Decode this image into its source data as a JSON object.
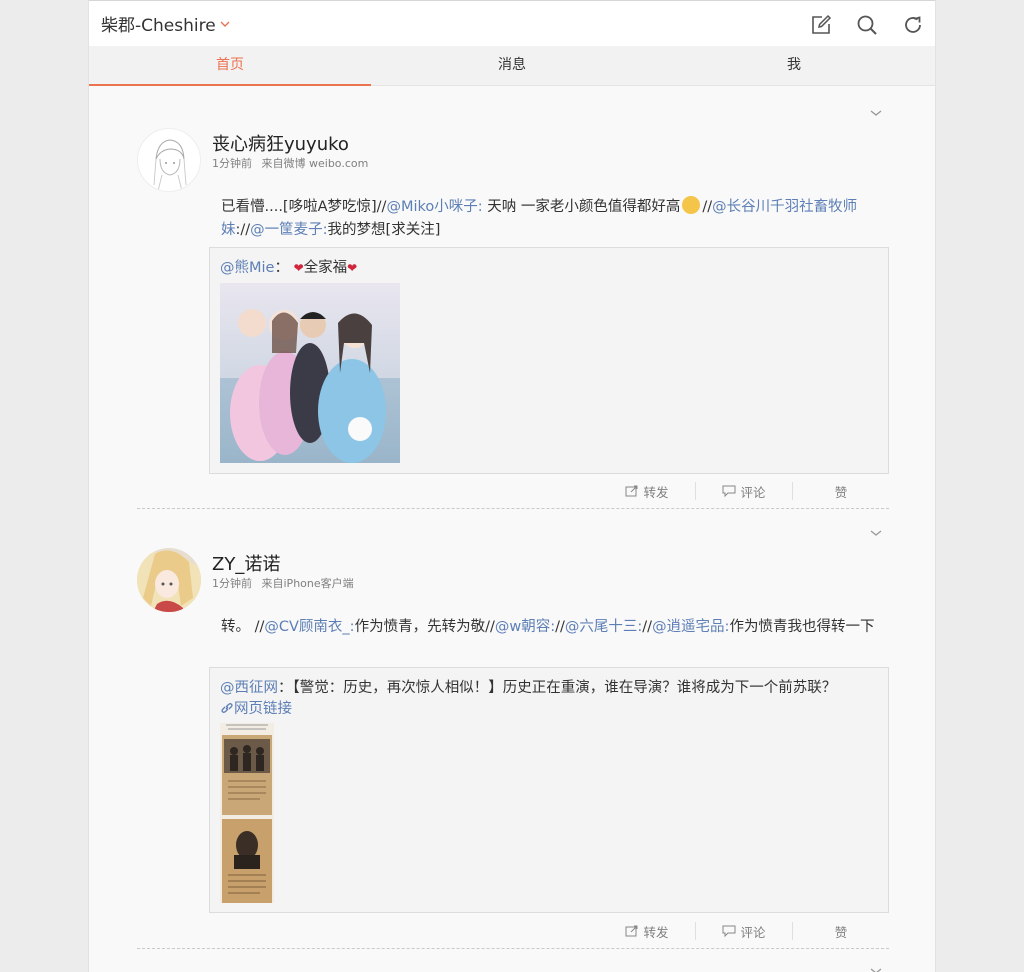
{
  "header": {
    "account_name": "柴郡-Cheshire",
    "icons": [
      "compose-icon",
      "search-icon",
      "refresh-icon"
    ]
  },
  "tabs": [
    {
      "label": "首页",
      "active": true
    },
    {
      "label": "消息",
      "active": false
    },
    {
      "label": "我",
      "active": false
    }
  ],
  "colors": {
    "accent": "#eb7350",
    "link": "#5d7fb5"
  },
  "posts": [
    {
      "username": "丧心病狂yuyuko",
      "time": "1分钟前",
      "source": "来自微博 weibo.com",
      "text": [
        {
          "t": "已看懵....[哆啦A梦吃惊]//",
          "link": false
        },
        {
          "t": "@Miko小咪子:",
          "link": true
        },
        {
          "t": " 天呐 一家老小颜色值得都好高",
          "link": false
        },
        {
          "t": "[emoji]",
          "link": false,
          "emoji": true
        },
        {
          "t": "//",
          "link": false
        },
        {
          "t": "@长谷川千羽社畜牧师妹",
          "link": true
        },
        {
          "t": "://",
          "link": false
        },
        {
          "t": "@一筐麦子:",
          "link": true
        },
        {
          "t": "我的梦想[求关注]",
          "link": false
        }
      ],
      "quote": {
        "author": "@熊Mie",
        "sep": "：",
        "heart_left": "❤",
        "body": "全家福",
        "heart_right": "❤"
      },
      "actions": {
        "repost": "转发",
        "comment": "评论",
        "like": "赞"
      }
    },
    {
      "username": "ZY_诺诺",
      "time": "1分钟前",
      "source": "来自iPhone客户端",
      "text": [
        {
          "t": "转。 //",
          "link": false
        },
        {
          "t": "@CV顾南衣_:",
          "link": true
        },
        {
          "t": "作为愤青，先转为敬//",
          "link": false
        },
        {
          "t": "@w朝容:",
          "link": true
        },
        {
          "t": "//",
          "link": false
        },
        {
          "t": "@六尾十三:",
          "link": true
        },
        {
          "t": "//",
          "link": false
        },
        {
          "t": "@逍遥宅品:",
          "link": true
        },
        {
          "t": "作为愤青我也得转一下",
          "link": false
        }
      ],
      "quote": {
        "author": "@西征网",
        "sep": "：",
        "body": "【警觉：历史，再次惊人相似！】历史正在重演，谁在导演？谁将成为下一个前苏联？",
        "link_label": "网页链接"
      },
      "actions": {
        "repost": "转发",
        "comment": "评论",
        "like": "赞"
      }
    }
  ]
}
